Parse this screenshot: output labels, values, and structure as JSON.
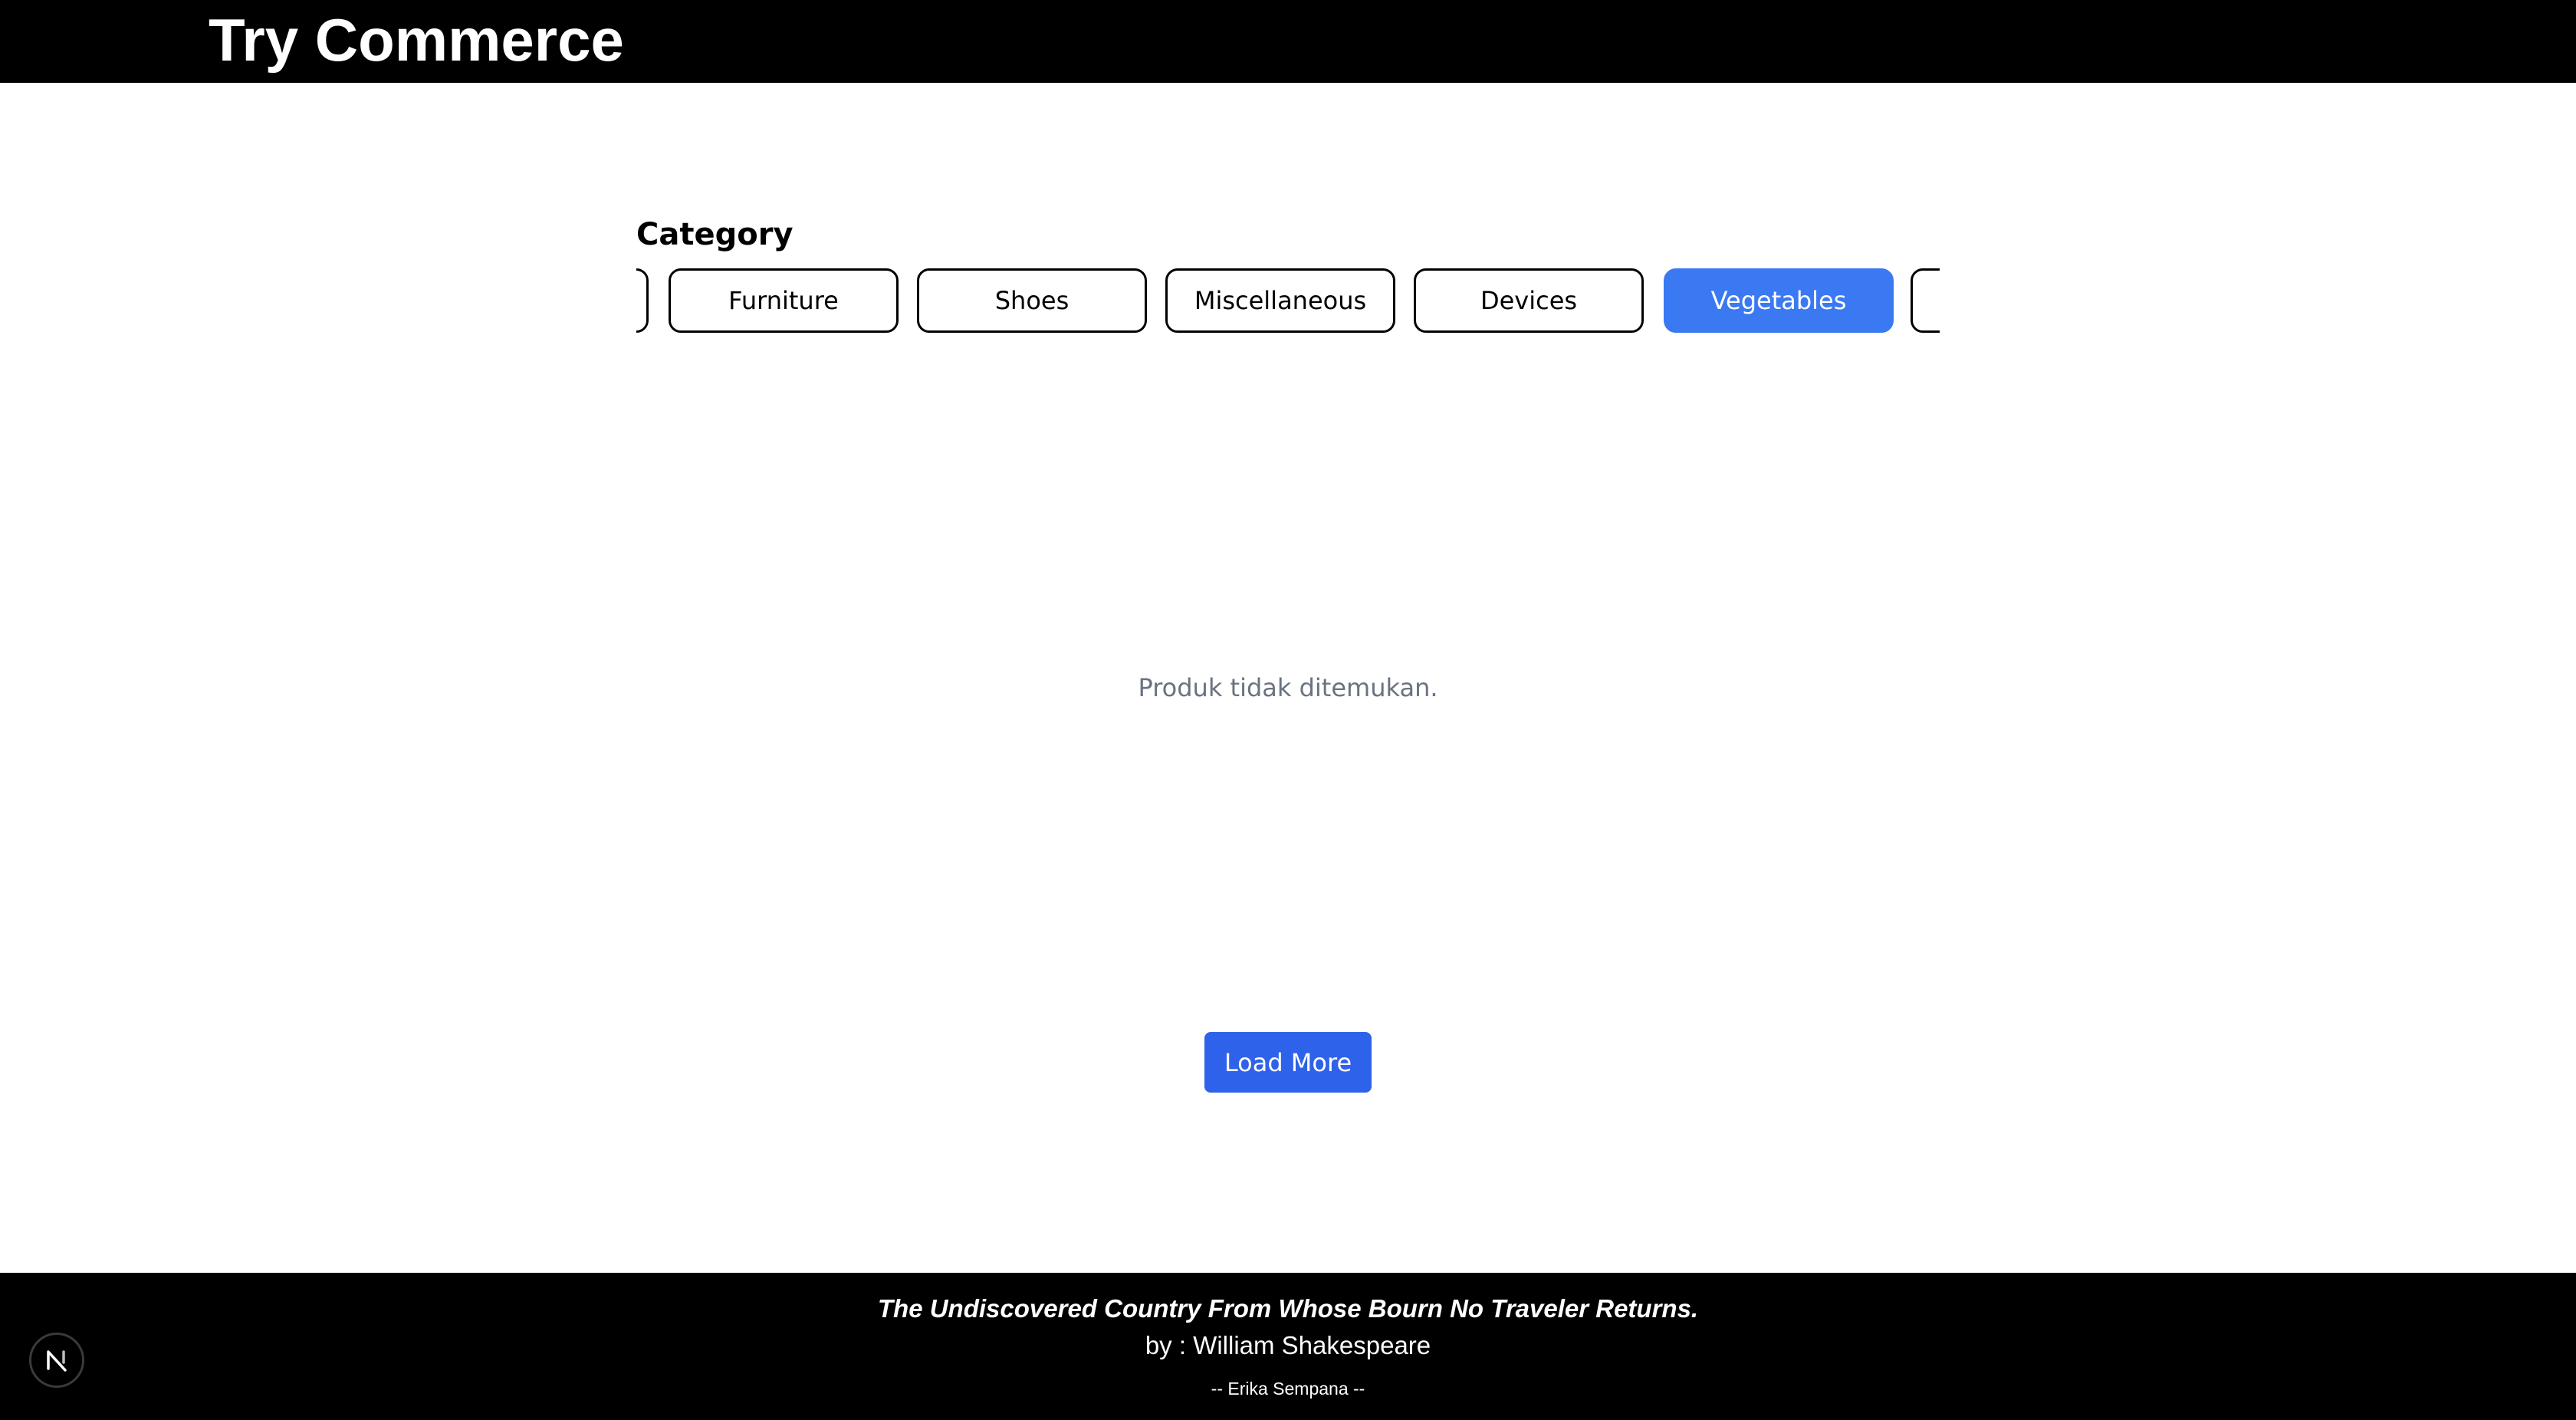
{
  "header": {
    "brand": "Try Commerce"
  },
  "category": {
    "title": "Category",
    "items": [
      {
        "label": ""
      },
      {
        "label": "Furniture"
      },
      {
        "label": "Shoes"
      },
      {
        "label": "Miscellaneous"
      },
      {
        "label": "Devices"
      },
      {
        "label": "Vegetables",
        "selected": true
      },
      {
        "label": ""
      }
    ]
  },
  "main": {
    "empty_message": "Produk tidak ditemukan.",
    "load_more_label": "Load More"
  },
  "footer": {
    "quote": "The Undiscovered Country From Whose Bourn No Traveler Returns.",
    "author": "by : William Shakespeare",
    "credit": "-- Erika Sempana --"
  },
  "colors": {
    "header_bg": "#000000",
    "selected_category": "#3b79f3",
    "load_more": "#2f62ea",
    "muted_text": "#6b7280"
  },
  "icons": {
    "dev_badge": "nextjs-icon"
  }
}
